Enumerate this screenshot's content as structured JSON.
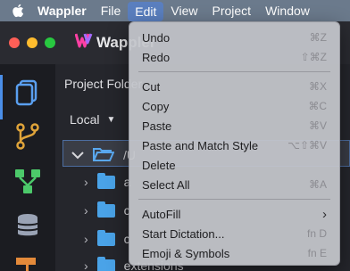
{
  "menubar": {
    "app_name": "Wappler",
    "items": [
      "File",
      "Edit",
      "View",
      "Project",
      "Window"
    ],
    "active": "Edit"
  },
  "app": {
    "brand": "Wappler",
    "panel_title": "Project Folder",
    "location_select": "Local",
    "tree": {
      "root_label": "/U",
      "children": [
        "a",
        "c",
        "c",
        "extensions"
      ]
    }
  },
  "edit_menu": {
    "groups": [
      [
        {
          "label": "Undo",
          "shortcut": "⌘Z"
        },
        {
          "label": "Redo",
          "shortcut": "⇧⌘Z"
        }
      ],
      [
        {
          "label": "Cut",
          "shortcut": "⌘X"
        },
        {
          "label": "Copy",
          "shortcut": "⌘C"
        },
        {
          "label": "Paste",
          "shortcut": "⌘V"
        },
        {
          "label": "Paste and Match Style",
          "shortcut": "⌥⇧⌘V"
        },
        {
          "label": "Delete",
          "shortcut": ""
        },
        {
          "label": "Select All",
          "shortcut": "⌘A"
        }
      ],
      [
        {
          "label": "AutoFill",
          "shortcut": "›"
        },
        {
          "label": "Start Dictation...",
          "shortcut": "fn D"
        },
        {
          "label": "Emoji & Symbols",
          "shortcut": "fn E"
        }
      ]
    ]
  },
  "colors": {
    "menubar_bg": "#6b7a8c",
    "menu_highlight": "#5a7fbf",
    "folder": "#4aa3e8",
    "accent": "#4a8ee8"
  }
}
